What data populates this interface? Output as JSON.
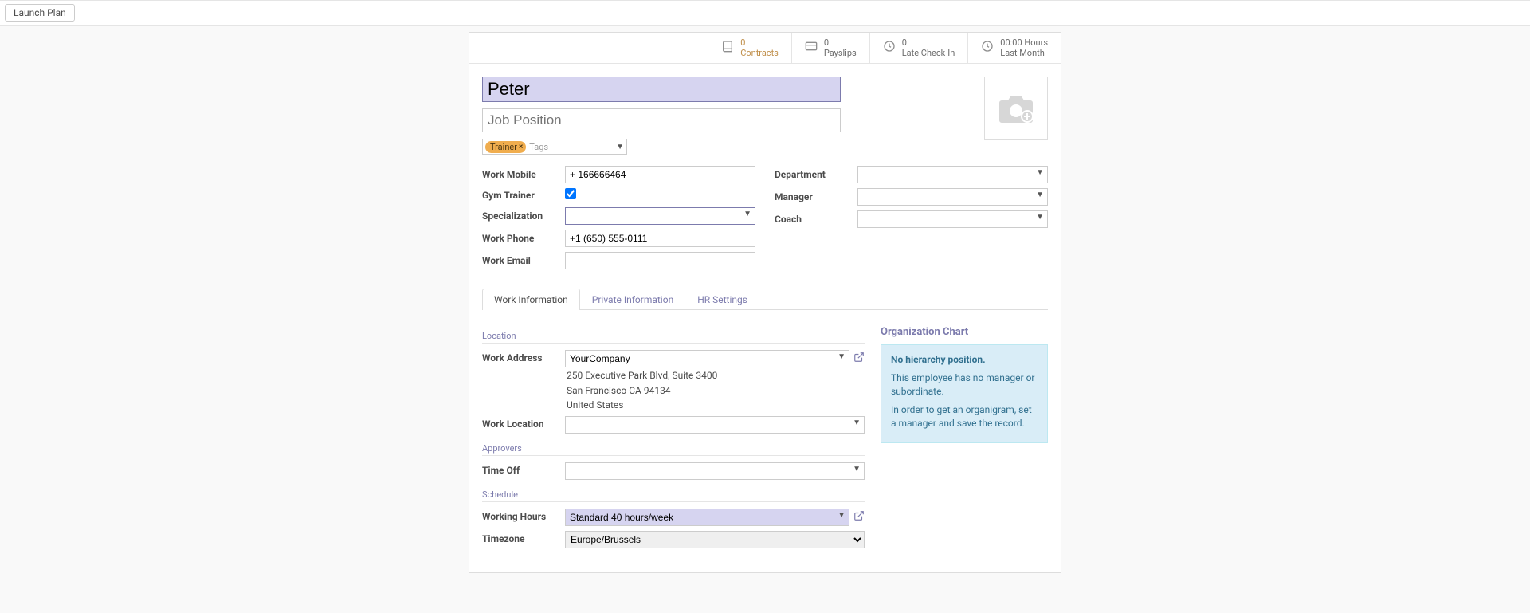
{
  "launch_plan": "Launch Plan",
  "stats": {
    "contracts_num": "0",
    "contracts_label": "Contracts",
    "payslips_num": "0",
    "payslips_label": "Payslips",
    "late_num": "0",
    "late_label": "Late Check-In",
    "hours_num": "00:00 Hours",
    "hours_label": "Last Month"
  },
  "name_value": "Peter",
  "job_placeholder": "Job Position",
  "tags": {
    "chip": "Trainer",
    "placeholder": "Tags"
  },
  "left_fields": {
    "work_mobile_label": "Work Mobile",
    "work_mobile_value": "+ 166666464",
    "gym_trainer_label": "Gym Trainer",
    "specialization_label": "Specialization",
    "work_phone_label": "Work Phone",
    "work_phone_value": "+1 (650) 555-0111",
    "work_email_label": "Work Email"
  },
  "right_fields": {
    "department_label": "Department",
    "manager_label": "Manager",
    "coach_label": "Coach"
  },
  "tabs": {
    "work_info": "Work Information",
    "private_info": "Private Information",
    "hr_settings": "HR Settings"
  },
  "location": {
    "section": "Location",
    "work_address_label": "Work Address",
    "work_address_value": "YourCompany",
    "address_line1": "250 Executive Park Blvd, Suite 3400",
    "address_line2": "San Francisco CA 94134",
    "address_line3": "United States",
    "work_location_label": "Work Location"
  },
  "approvers": {
    "section": "Approvers",
    "time_off_label": "Time Off"
  },
  "schedule": {
    "section": "Schedule",
    "working_hours_label": "Working Hours",
    "working_hours_value": "Standard 40 hours/week",
    "timezone_label": "Timezone",
    "timezone_value": "Europe/Brussels"
  },
  "org": {
    "title": "Organization Chart",
    "strong": "No hierarchy position.",
    "p1": "This employee has no manager or subordinate.",
    "p2": "In order to get an organigram, set a manager and save the record."
  }
}
